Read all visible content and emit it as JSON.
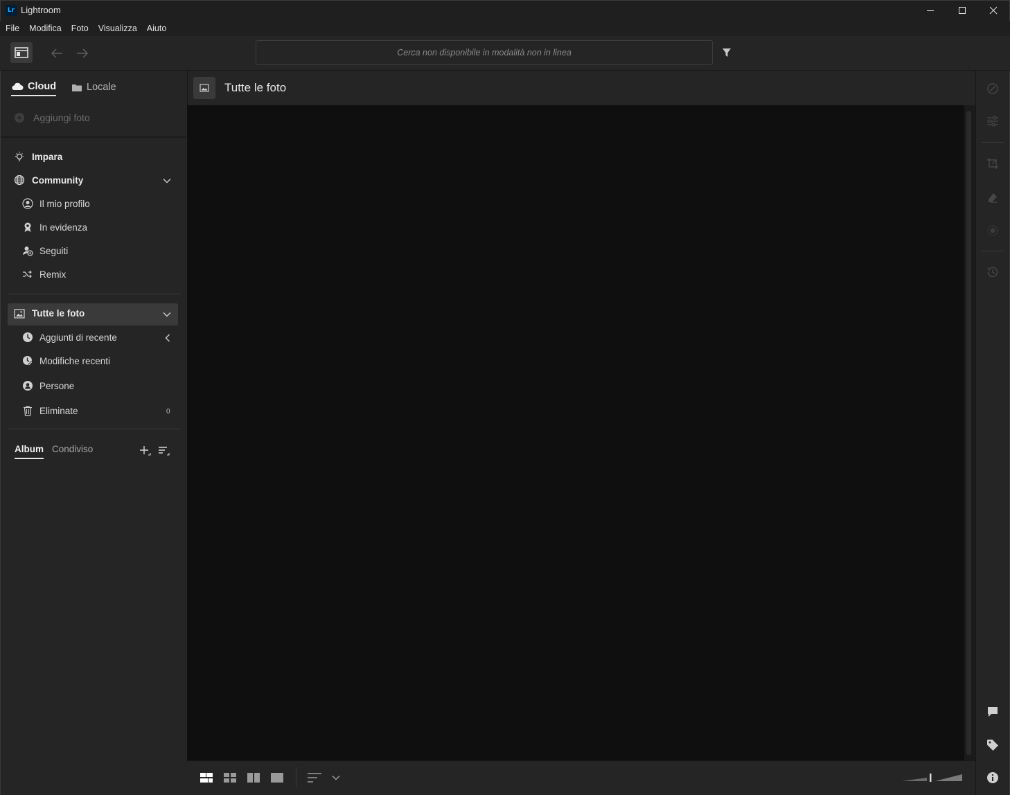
{
  "window": {
    "logo_text": "Lr",
    "title": "Lightroom"
  },
  "menu": [
    "File",
    "Modifica",
    "Foto",
    "Visualizza",
    "Aiuto"
  ],
  "search": {
    "placeholder": "Cerca non disponibile in modalità non in linea"
  },
  "sources": {
    "cloud": "Cloud",
    "local": "Locale",
    "add_photo": "Aggiungi foto"
  },
  "nav": {
    "learn": "Impara",
    "community": "Community",
    "community_items": [
      "Il mio profilo",
      "In evidenza",
      "Seguiti",
      "Remix"
    ],
    "all_photos": "Tutte le foto",
    "photo_items": [
      "Aggiunti di recente",
      "Modifiche recenti",
      "Persone",
      "Eliminate"
    ],
    "deleted_count": "0"
  },
  "albums": {
    "tab_album": "Album",
    "tab_shared": "Condiviso"
  },
  "center": {
    "title": "Tutte le foto"
  },
  "icons": {
    "titlebar": [
      "minimize-icon",
      "maximize-icon",
      "close-icon"
    ],
    "right_panel": [
      "edit-icon",
      "sliders-icon",
      "crop-icon",
      "healing-icon",
      "masking-icon",
      "history-icon",
      "comment-icon",
      "tag-icon",
      "info-icon"
    ]
  }
}
